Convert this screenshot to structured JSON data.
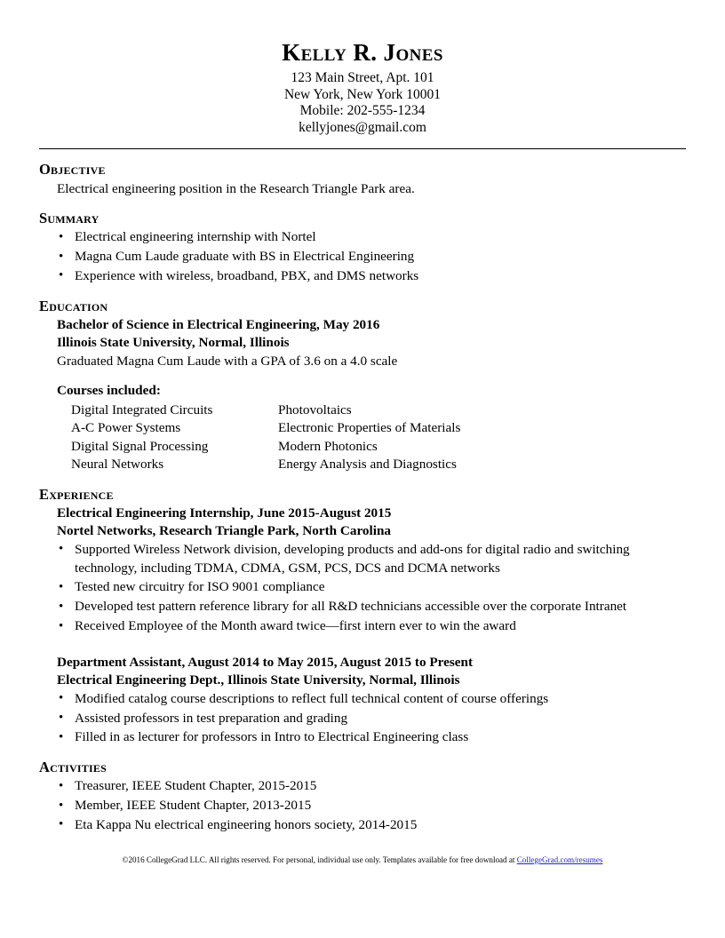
{
  "header": {
    "name": "Kelly R. Jones",
    "address_line1": "123 Main Street, Apt. 101",
    "address_line2": "New York, New York 10001",
    "phone": "Mobile: 202-555-1234",
    "email": "kellyjones@gmail.com"
  },
  "objective": {
    "heading": "Objective",
    "text": "Electrical engineering position in the Research Triangle Park area."
  },
  "summary": {
    "heading": "Summary",
    "items": [
      "Electrical engineering internship with Nortel",
      "Magna Cum Laude graduate with BS in Electrical Engineering",
      "Experience with wireless, broadband, PBX, and DMS networks"
    ]
  },
  "education": {
    "heading": "Education",
    "degree": "Bachelor of Science in Electrical Engineering, May 2016",
    "school": "Illinois State University, Normal, Illinois",
    "honors": "Graduated Magna Cum Laude with a GPA of 3.6 on a 4.0 scale",
    "courses_heading": "Courses included:",
    "courses": [
      [
        "Digital Integrated Circuits",
        "Photovoltaics"
      ],
      [
        "A-C Power Systems",
        "Electronic Properties of Materials"
      ],
      [
        "Digital Signal Processing",
        "Modern Photonics"
      ],
      [
        "Neural Networks",
        "Energy Analysis and Diagnostics"
      ]
    ]
  },
  "experience": {
    "heading": "Experience",
    "entries": [
      {
        "title": "Electrical Engineering Internship, June 2015-August 2015",
        "organization": "Nortel Networks, Research Triangle Park, North Carolina",
        "bullets": [
          "Supported Wireless Network division, developing products and add-ons for digital radio and switching technology, including TDMA, CDMA, GSM, PCS, DCS and DCMA networks",
          "Tested new circuitry for ISO 9001 compliance",
          "Developed test pattern reference library for all R&D technicians accessible over the corporate Intranet",
          "Received Employee of the Month award twice—first intern ever to win the award"
        ]
      },
      {
        "title": "Department Assistant, August 2014 to May 2015, August 2015 to Present",
        "organization": "Electrical Engineering Dept., Illinois State University, Normal, Illinois",
        "bullets": [
          "Modified catalog course descriptions to reflect full technical content of course offerings",
          "Assisted professors in test preparation and grading",
          "Filled in as lecturer for professors in Intro to Electrical Engineering class"
        ]
      }
    ]
  },
  "activities": {
    "heading": "Activities",
    "items": [
      "Treasurer, IEEE Student Chapter, 2015-2015",
      "Member, IEEE Student Chapter, 2013-2015",
      "Eta Kappa Nu electrical engineering honors society, 2014-2015"
    ]
  },
  "footer": {
    "text": "©2016 CollegeGrad LLC.  All rights reserved.  For personal, individual use only.  Templates available for free download at ",
    "link_text": "CollegeGrad.com/resumes",
    "link_color": "#2222cc"
  }
}
